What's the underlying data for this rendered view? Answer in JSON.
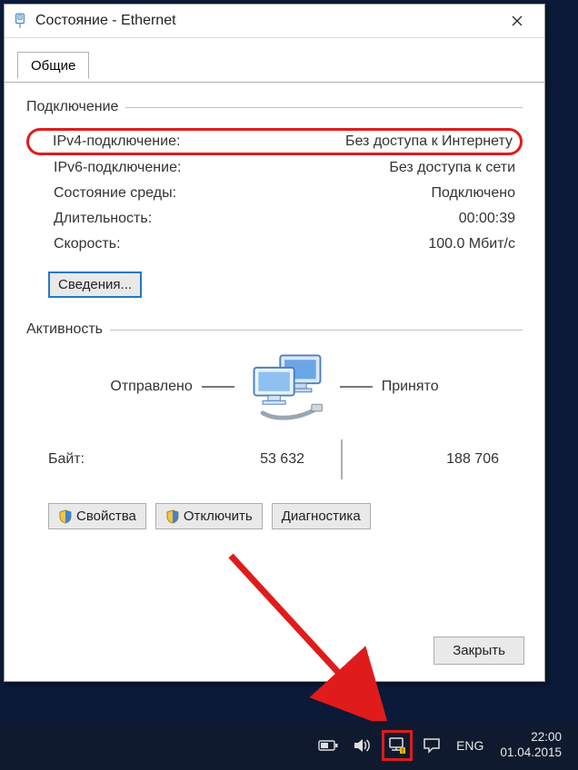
{
  "window": {
    "title": "Состояние - Ethernet"
  },
  "tab": {
    "label": "Общие"
  },
  "connection": {
    "header": "Подключение",
    "rows": {
      "ipv4_label": "IPv4-подключение:",
      "ipv4_value": "Без доступа к Интернету",
      "ipv6_label": "IPv6-подключение:",
      "ipv6_value": "Без доступа к сети",
      "media_label": "Состояние среды:",
      "media_value": "Подключено",
      "duration_label": "Длительность:",
      "duration_value": "00:00:39",
      "speed_label": "Скорость:",
      "speed_value": "100.0 Мбит/с"
    },
    "details_button": "Сведения..."
  },
  "activity": {
    "header": "Активность",
    "sent_label": "Отправлено",
    "recv_label": "Принято",
    "bytes_label": "Байт:",
    "bytes_sent": "53 632",
    "bytes_recv": "188 706"
  },
  "buttons": {
    "properties": "Свойства",
    "disable": "Отключить",
    "diagnose": "Диагностика",
    "close": "Закрыть"
  },
  "taskbar": {
    "lang": "ENG",
    "time": "22:00",
    "date": "01.04.2015"
  }
}
